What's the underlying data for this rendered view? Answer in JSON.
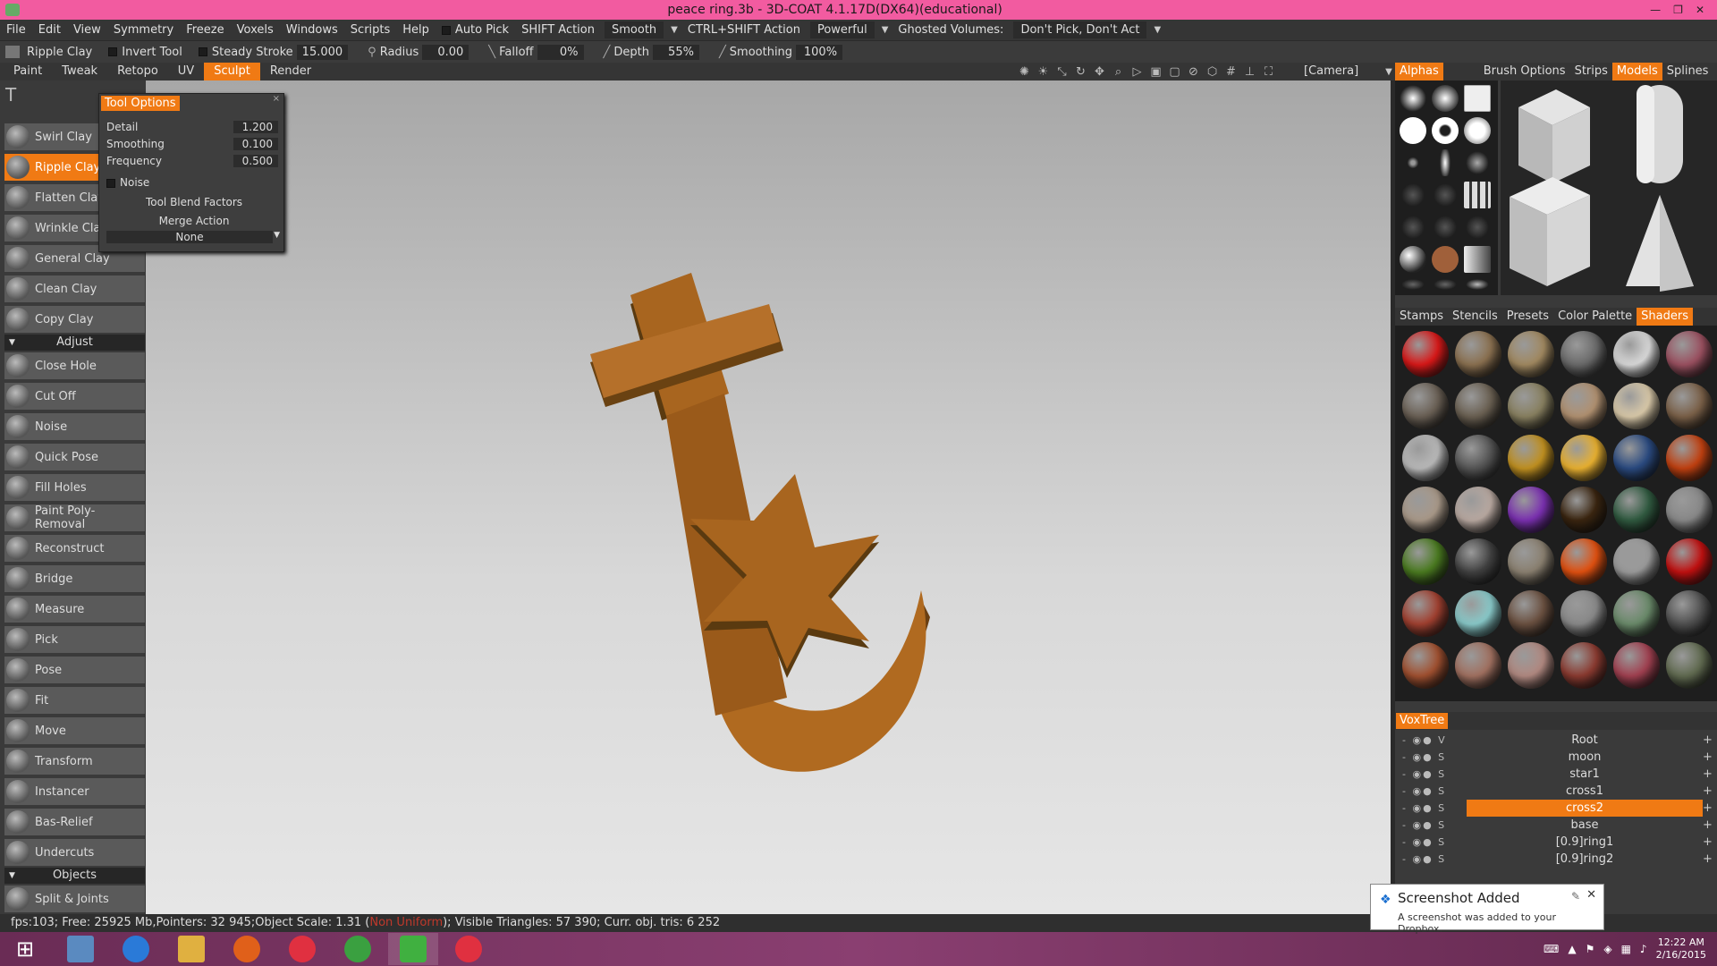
{
  "window": {
    "title": "peace ring.3b - 3D-COAT 4.1.17D(DX64)(educational)"
  },
  "menu": {
    "items": [
      "File",
      "Edit",
      "View",
      "Symmetry",
      "Freeze",
      "Voxels",
      "Windows",
      "Scripts",
      "Help"
    ],
    "auto_pick": "Auto Pick",
    "shift_action_label": "SHIFT Action",
    "shift_action_value": "Smooth",
    "ctrl_shift_label": "CTRL+SHIFT Action",
    "ctrl_shift_value": "Powerful",
    "ghosted_label": "Ghosted Volumes:",
    "ghosted_value": "Don't Pick, Don't Act"
  },
  "toolbar": {
    "tool_name": "Ripple Clay",
    "invert": "Invert Tool",
    "steady_label": "Steady Stroke",
    "steady_value": "15.000",
    "radius_label": "Radius",
    "radius_value": "0.00",
    "falloff_label": "Falloff",
    "falloff_value": "0%",
    "depth_label": "Depth",
    "depth_value": "55%",
    "smoothing_label": "Smoothing",
    "smoothing_value": "100%"
  },
  "rooms": [
    "Paint",
    "Tweak",
    "Retopo",
    "UV",
    "Sculpt",
    "Render"
  ],
  "camera": "[Camera]",
  "tools": {
    "items": [
      "Swirl Clay",
      "Ripple Clay",
      "Flatten Clay",
      "Wrinkle Clay",
      "General Clay",
      "Clean Clay",
      "Copy Clay"
    ],
    "adjust_header": "Adjust",
    "adjust": [
      "Close Hole",
      "Cut Off",
      "Noise",
      "Quick Pose",
      "Fill Holes",
      "Paint Poly-Removal",
      "Reconstruct",
      "Bridge",
      "Measure",
      "Pick",
      "Pose",
      "Fit",
      "Move",
      "Transform",
      "Instancer",
      "Bas-Relief",
      "Undercuts"
    ],
    "objects_header": "Objects",
    "objects": [
      "Split & Joints"
    ]
  },
  "tool_options": {
    "title": "Tool Options",
    "detail_label": "Detail",
    "detail_value": "1.200",
    "smoothing_label": "Smoothing",
    "smoothing_value": "0.100",
    "frequency_label": "Frequency",
    "frequency_value": "0.500",
    "noise_label": "Noise",
    "blend_label": "Tool Blend Factors",
    "merge_label": "Merge Action",
    "merge_value": "None"
  },
  "right_tabs": [
    "Alphas",
    "Brush Options",
    "Strips",
    "Models",
    "Splines"
  ],
  "mid_tabs": [
    "Stamps",
    "Stencils",
    "Presets",
    "Color Palette",
    "Shaders"
  ],
  "voxtree": {
    "title": "VoxTree",
    "root": "Root",
    "layers": [
      "moon",
      "star1",
      "cross1",
      "cross2",
      "base",
      "[0.9]ring1",
      "[0.9]ring2"
    ],
    "selected": "cross2"
  },
  "status": {
    "left": "fps:103;   Free: 25925 Mb,Pointers: 32 945;Object Scale: 1.31 (",
    "warning": "Non Uniform",
    "right": "); Visible  Triangles: 57 390; Curr. obj. tris: 6 252"
  },
  "notification": {
    "title": "Screenshot Added",
    "message": "A screenshot was added to your Dropbox."
  },
  "clock": {
    "time": "12:22 AM",
    "date": "2/16/2015"
  },
  "colors": {
    "accent": "#f07a14",
    "titlebar": "#f25ba0",
    "model": "#b06a20"
  }
}
